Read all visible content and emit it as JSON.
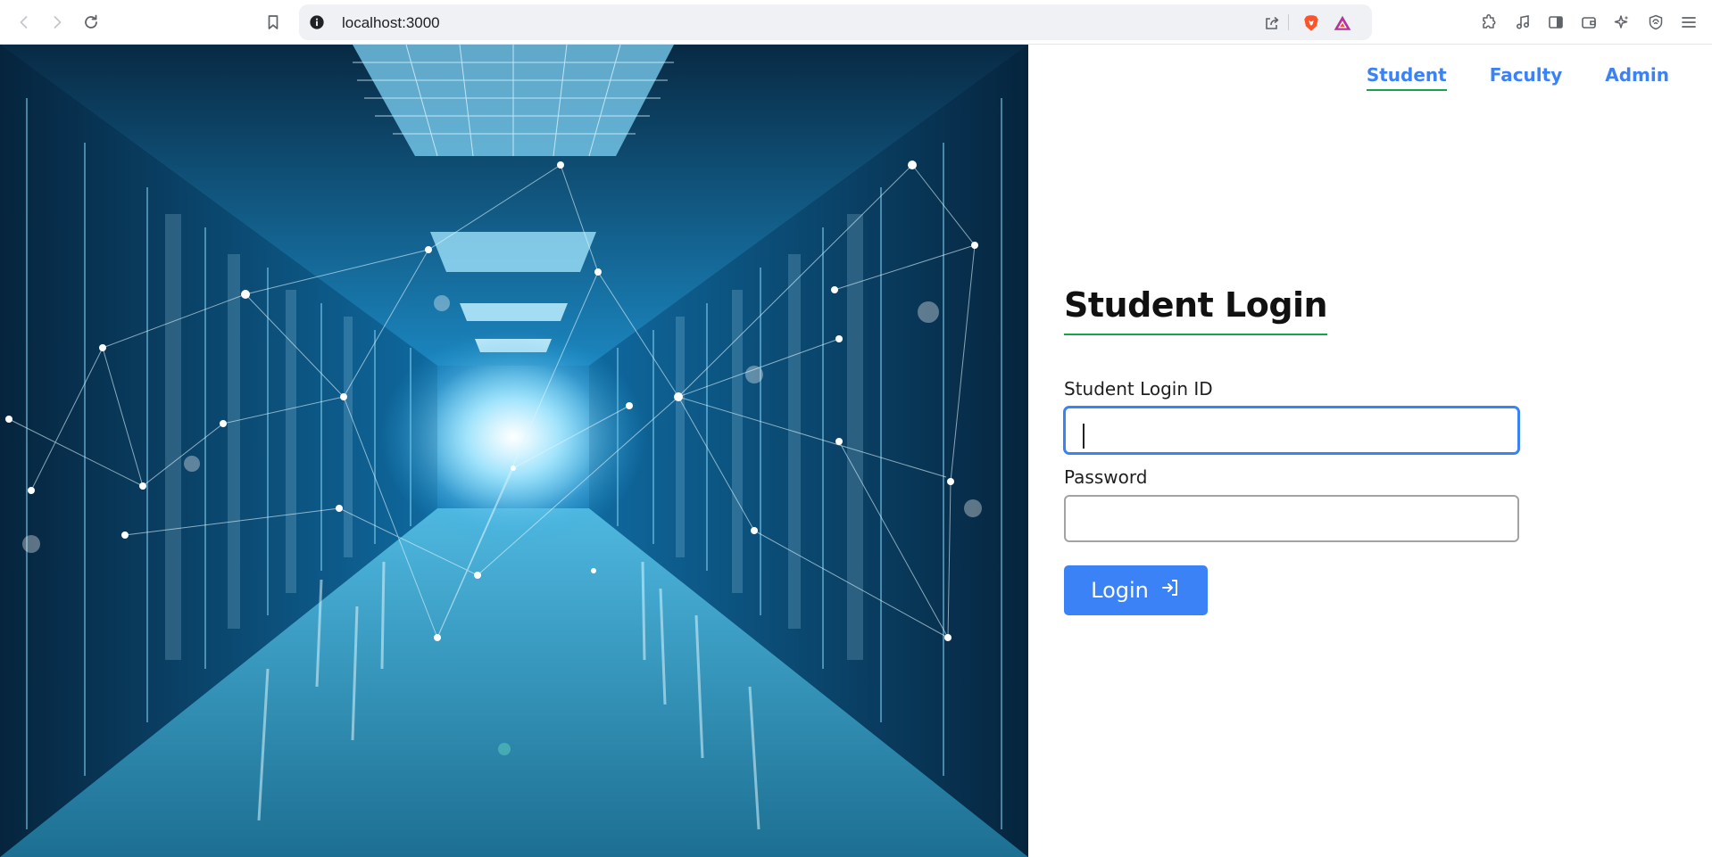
{
  "browser": {
    "url": "localhost:3000",
    "icons": [
      "back-icon",
      "forward-icon",
      "reload-icon",
      "bookmark-icon",
      "site-info-icon",
      "share-icon",
      "brave-shields-icon",
      "brave-rewards-icon",
      "extensions-icon",
      "media-icon",
      "sidebar-icon",
      "wallet-icon",
      "leo-ai-icon",
      "vpn-icon",
      "menu-icon"
    ]
  },
  "nav": {
    "student": "Student",
    "faculty": "Faculty",
    "admin": "Admin",
    "active": "Student"
  },
  "form": {
    "title": "Student Login",
    "login_id_label": "Student Login ID",
    "login_id_value": "",
    "password_label": "Password",
    "password_value": "",
    "submit_label": "Login"
  },
  "colors": {
    "accent": "#3b82f6",
    "underline": "#16a34a"
  }
}
